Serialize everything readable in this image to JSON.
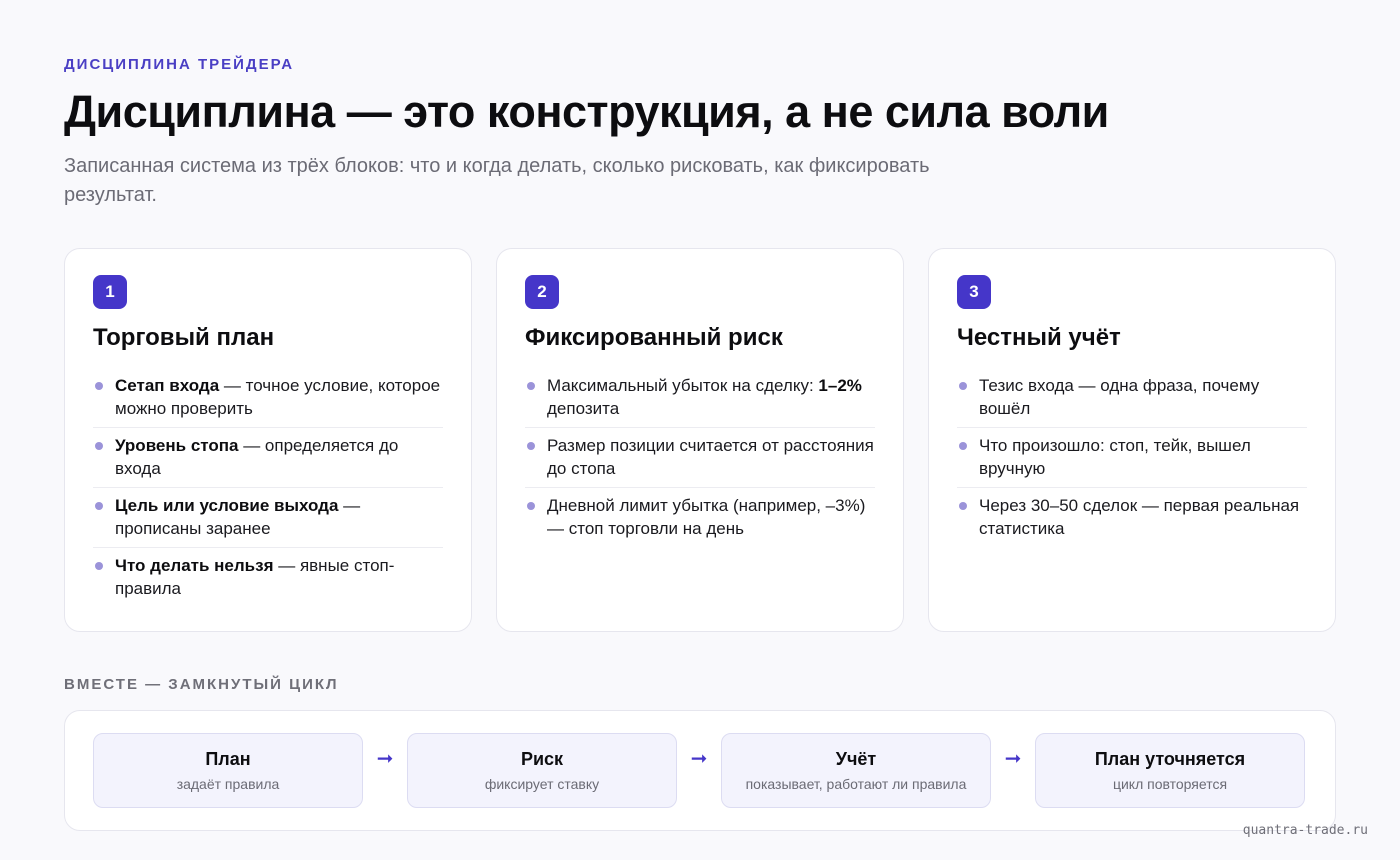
{
  "header": {
    "eyebrow": "ДИСЦИПЛИНА ТРЕЙДЕРА",
    "title": "Дисциплина — это конструкция, а не сила воли",
    "subtitle": "Записанная система из трёх блоков: что и когда делать, сколько рисковать, как фиксировать результат."
  },
  "cards": [
    {
      "number": "1",
      "title": "Торговый план",
      "items": [
        {
          "bold": "Сетап входа",
          "text": " — точное условие, которое можно проверить"
        },
        {
          "bold": "Уровень стопа",
          "text": " — определяется до входа"
        },
        {
          "bold": "Цель или условие выхода",
          "text": " — прописаны заранее"
        },
        {
          "bold": "Что делать нельзя",
          "text": " — явные стоп-правила"
        }
      ]
    },
    {
      "number": "2",
      "title": "Фиксированный риск",
      "items": [
        {
          "pre": "Максимальный убыток на сделку: ",
          "bold": "1–2%",
          "text": " депозита"
        },
        {
          "text": "Размер позиции считается от расстояния до стопа"
        },
        {
          "text": "Дневной лимит убытка (например, –3%) — стоп торговли на день"
        }
      ]
    },
    {
      "number": "3",
      "title": "Честный учёт",
      "items": [
        {
          "text": "Тезис входа — одна фраза, почему вошёл"
        },
        {
          "text": "Что произошло: стоп, тейк, вышел вручную"
        },
        {
          "text": "Через 30–50 сделок — первая реальная статистика"
        }
      ]
    }
  ],
  "cycle": {
    "label": "ВМЕСТЕ — ЗАМКНУТЫЙ ЦИКЛ",
    "arrow": "➞",
    "steps": [
      {
        "title": "План",
        "subtitle": "задаёт правила"
      },
      {
        "title": "Риск",
        "subtitle": "фиксирует ставку"
      },
      {
        "title": "Учёт",
        "subtitle": "показывает, работают ли правила"
      },
      {
        "title": "План уточняется",
        "subtitle": "цикл повторяется"
      }
    ]
  },
  "footer": {
    "site": "quantra-trade.ru"
  },
  "colors": {
    "accent": "#4536c9",
    "bullet": "#9b93d9",
    "step_bg": "#f3f3fd"
  }
}
